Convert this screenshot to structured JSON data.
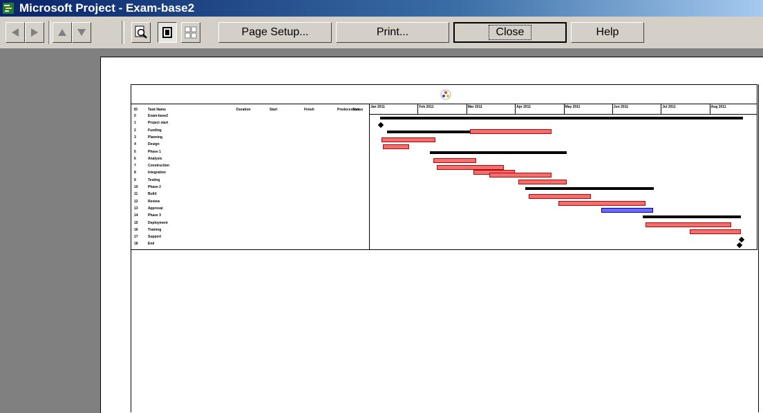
{
  "window": {
    "title": "Microsoft Project - Exam-base2"
  },
  "toolbar": {
    "page_setup_label": "Page Setup...",
    "print_label": "Print...",
    "close_label": "Close",
    "help_label": "Help"
  },
  "gantt": {
    "columns": [
      "ID",
      "Task Name",
      "Duration",
      "Start",
      "Finish",
      "Predecessors",
      "Status"
    ],
    "timeline_labels": [
      "Jan 2011",
      "Feb 2011",
      "Mar 2011",
      "Apr 2011",
      "May 2011",
      "Jun 2011",
      "Jul 2011",
      "Aug 2011"
    ],
    "rows": [
      {
        "id": "0",
        "name": "Exam-base2",
        "duration": "",
        "start": "",
        "finish": "",
        "pred": "",
        "status": ""
      },
      {
        "id": "1",
        "name": "Project start",
        "duration": "",
        "start": "",
        "finish": "",
        "pred": "",
        "status": ""
      },
      {
        "id": "2",
        "name": "Funding",
        "duration": "",
        "start": "",
        "finish": "",
        "pred": "",
        "status": ""
      },
      {
        "id": "3",
        "name": "Planning",
        "duration": "",
        "start": "",
        "finish": "",
        "pred": "",
        "status": ""
      },
      {
        "id": "4",
        "name": "Design",
        "duration": "",
        "start": "",
        "finish": "",
        "pred": "",
        "status": ""
      },
      {
        "id": "5",
        "name": "Phase 1",
        "duration": "",
        "start": "",
        "finish": "",
        "pred": "",
        "status": ""
      },
      {
        "id": "6",
        "name": "Analysis",
        "duration": "",
        "start": "",
        "finish": "",
        "pred": "",
        "status": ""
      },
      {
        "id": "7",
        "name": "Construction",
        "duration": "",
        "start": "",
        "finish": "",
        "pred": "",
        "status": ""
      },
      {
        "id": "8",
        "name": "Integration",
        "duration": "",
        "start": "",
        "finish": "",
        "pred": "",
        "status": ""
      },
      {
        "id": "9",
        "name": "Testing",
        "duration": "",
        "start": "",
        "finish": "",
        "pred": "",
        "status": ""
      },
      {
        "id": "10",
        "name": "Phase 2",
        "duration": "",
        "start": "",
        "finish": "",
        "pred": "",
        "status": ""
      },
      {
        "id": "11",
        "name": "Build",
        "duration": "",
        "start": "",
        "finish": "",
        "pred": "",
        "status": ""
      },
      {
        "id": "12",
        "name": "Review",
        "duration": "",
        "start": "",
        "finish": "",
        "pred": "",
        "status": ""
      },
      {
        "id": "13",
        "name": "Approval",
        "duration": "",
        "start": "",
        "finish": "",
        "pred": "",
        "status": ""
      },
      {
        "id": "14",
        "name": "Phase 3",
        "duration": "",
        "start": "",
        "finish": "",
        "pred": "",
        "status": ""
      },
      {
        "id": "15",
        "name": "Deployment",
        "duration": "",
        "start": "",
        "finish": "",
        "pred": "",
        "status": ""
      },
      {
        "id": "16",
        "name": "Training",
        "duration": "",
        "start": "",
        "finish": "",
        "pred": "",
        "status": ""
      },
      {
        "id": "17",
        "name": "Support",
        "duration": "",
        "start": "",
        "finish": "",
        "pred": "",
        "status": ""
      },
      {
        "id": "18",
        "name": "End",
        "duration": "",
        "start": "",
        "finish": "",
        "pred": "",
        "status": ""
      }
    ]
  },
  "colors": {
    "task_bar": "#f07070",
    "critical_bar": "#6b6bff",
    "title_blue": "#0a246a"
  },
  "icons": [
    "app-icon",
    "prev-page-icon",
    "next-page-icon",
    "up-page-icon",
    "down-page-icon",
    "zoom-icon",
    "one-page-icon",
    "multi-page-icon",
    "logo-icon"
  ]
}
